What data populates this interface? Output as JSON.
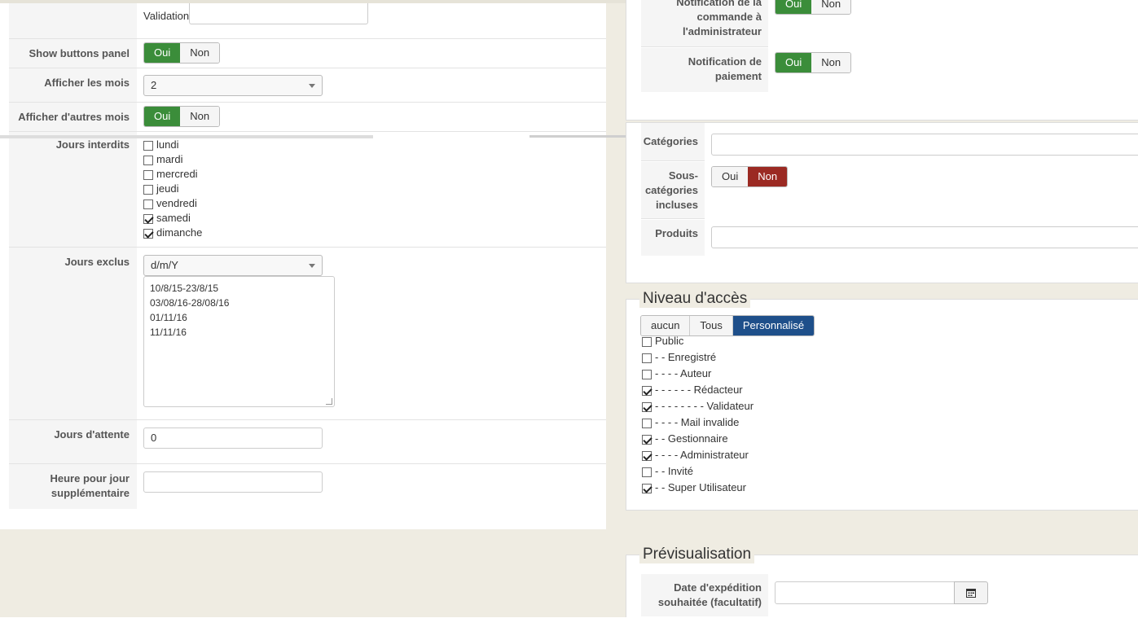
{
  "left": {
    "validation": {
      "label": "Validation",
      "value": ""
    },
    "show_buttons_panel": {
      "label": "Show buttons panel",
      "yes": "Oui",
      "no": "Non"
    },
    "afficher_mois": {
      "label": "Afficher les mois",
      "value": "2"
    },
    "afficher_autres_mois": {
      "label": "Afficher d'autres mois",
      "yes": "Oui",
      "no": "Non"
    },
    "jours_interdits": {
      "label": "Jours interdits",
      "days": [
        {
          "label": "lundi",
          "checked": false
        },
        {
          "label": "mardi",
          "checked": false
        },
        {
          "label": "mercredi",
          "checked": false
        },
        {
          "label": "jeudi",
          "checked": false
        },
        {
          "label": "vendredi",
          "checked": false
        },
        {
          "label": "samedi",
          "checked": true
        },
        {
          "label": "dimanche",
          "checked": true
        }
      ]
    },
    "jours_exclus": {
      "label": "Jours exclus",
      "format": "d/m/Y",
      "lines": [
        "10/8/15-23/8/15",
        "03/08/16-28/08/16",
        "01/11/16",
        "11/11/16"
      ]
    },
    "jours_attente": {
      "label": "Jours d'attente",
      "value": "0"
    },
    "heure_jour_sup": {
      "label_line1": "Heure pour jour",
      "label_line2": "supplémentaire",
      "value": ""
    }
  },
  "right": {
    "notif_commande": {
      "line1": "Notification de la",
      "line2": "commande à",
      "line3": "l'administrateur",
      "yes": "Oui",
      "no": "Non"
    },
    "notif_paiement": {
      "line1": "Notification de",
      "line2": "paiement",
      "yes": "Oui",
      "no": "Non"
    },
    "categories": {
      "label": "Catégories"
    },
    "sous_categories": {
      "line1": "Sous-",
      "line2": "catégories",
      "line3": "incluses",
      "yes": "Oui",
      "no": "Non"
    },
    "produits": {
      "label": "Produits"
    },
    "niveau_acces": {
      "legend": "Niveau d'accès",
      "tabs": [
        "aucun",
        "Tous",
        "Personnalisé"
      ],
      "groups": [
        {
          "label": "Public",
          "checked": false
        },
        {
          "label": "- - Enregistré",
          "checked": false
        },
        {
          "label": "- - - - Auteur",
          "checked": false
        },
        {
          "label": "- - - - - - Rédacteur",
          "checked": true
        },
        {
          "label": "- - - - - - - - Validateur",
          "checked": true
        },
        {
          "label": "- - - - Mail invalide",
          "checked": false
        },
        {
          "label": "- - Gestionnaire",
          "checked": true
        },
        {
          "label": "- - - - Administrateur",
          "checked": true
        },
        {
          "label": "- - Invité",
          "checked": false
        },
        {
          "label": "- - Super Utilisateur",
          "checked": true
        }
      ]
    },
    "previsualisation": {
      "legend": "Prévisualisation",
      "date_line1": "Date d'expédition",
      "date_line2": "souhaitée (facultatif)",
      "date_value": ""
    }
  },
  "colors": {
    "green": "#3b8d3a",
    "red": "#9b2a23",
    "blue": "#1e4f8a"
  },
  "icons": {
    "calendar": "calendar-icon"
  }
}
